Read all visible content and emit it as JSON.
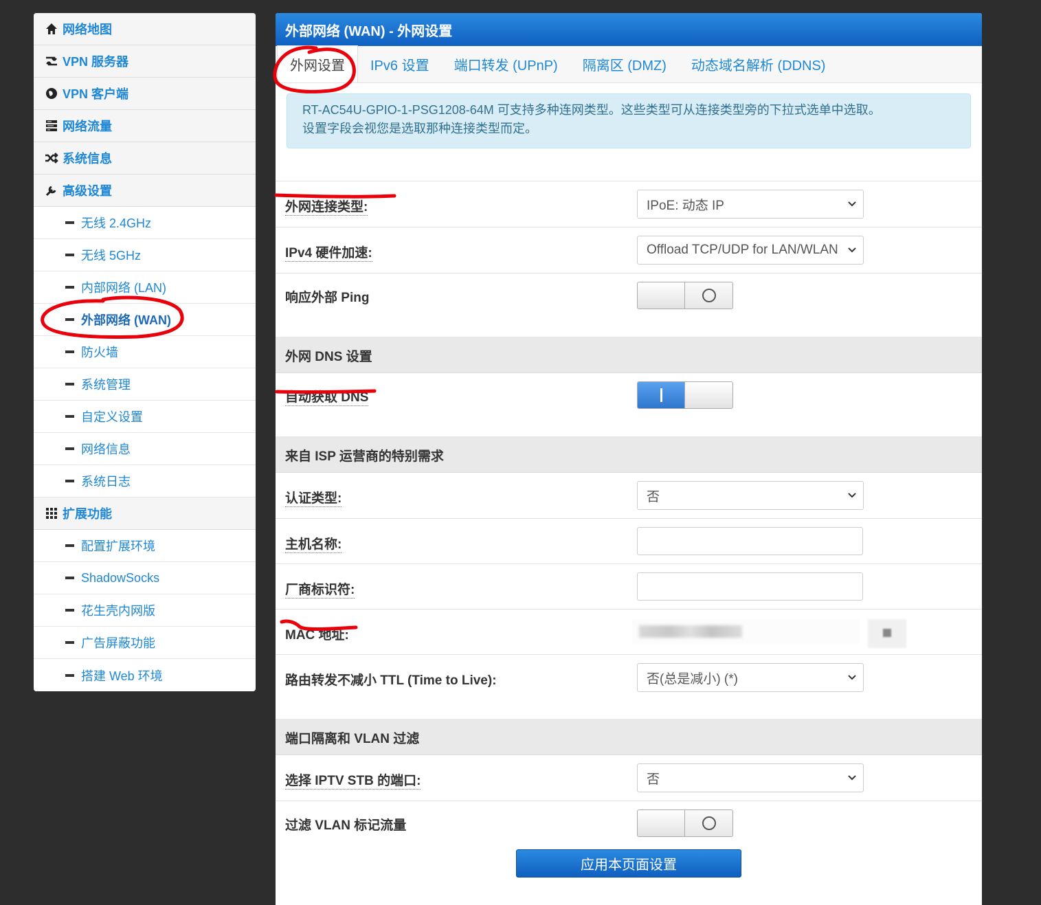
{
  "sidebar": {
    "items": [
      {
        "label": "网络地图",
        "icon": "home-icon"
      },
      {
        "label": "VPN 服务器",
        "icon": "retweet-icon"
      },
      {
        "label": "VPN 客户端",
        "icon": "globe-icon"
      },
      {
        "label": "网络流量",
        "icon": "tasks-icon"
      },
      {
        "label": "系统信息",
        "icon": "random-icon"
      },
      {
        "label": "高级设置",
        "icon": "wrench-icon"
      },
      {
        "label": "无线 2.4GHz"
      },
      {
        "label": "无线 5GHz"
      },
      {
        "label": "内部网络 (LAN)"
      },
      {
        "label": "外部网络 (WAN)"
      },
      {
        "label": "防火墙"
      },
      {
        "label": "系统管理"
      },
      {
        "label": "自定义设置"
      },
      {
        "label": "网络信息"
      },
      {
        "label": "系统日志"
      },
      {
        "label": "扩展功能",
        "icon": "grid-icon"
      },
      {
        "label": "配置扩展环境"
      },
      {
        "label": "ShadowSocks"
      },
      {
        "label": "花生壳内网版"
      },
      {
        "label": "广告屏蔽功能"
      },
      {
        "label": "搭建 Web 环境"
      }
    ]
  },
  "header": {
    "title": "外部网络 (WAN) - 外网设置"
  },
  "tabs": [
    "外网设置",
    "IPv6 设置",
    "端口转发 (UPnP)",
    "隔离区 (DMZ)",
    "动态域名解析 (DDNS)"
  ],
  "info": {
    "line1": "RT-AC54U-GPIO-1-PSG1208-64M 可支持多种连网类型。这些类型可从连接类型旁的下拉式选单中选取。",
    "line2": "设置字段会视您是选取那种连接类型而定。"
  },
  "form": {
    "wan_type_label": "外网连接类型:",
    "wan_type_value": "IPoE: 动态 IP",
    "hw_accel_label": "IPv4 硬件加速:",
    "hw_accel_value": "Offload TCP/UDP for LAN/WLAN",
    "ping_label": "响应外部 Ping",
    "dns_section": "外网 DNS 设置",
    "dns_auto_label": "自动获取 DNS",
    "isp_section": "来自 ISP 运营商的特别需求",
    "auth_label": "认证类型:",
    "auth_value": "否",
    "hostname_label": "主机名称:",
    "hostname_value": "",
    "vendor_label": "厂商标识符:",
    "vendor_value": "",
    "mac_label": "MAC 地址:",
    "ttl_label": "路由转发不减小 TTL (Time to Live):",
    "ttl_value": "否(总是减小) (*)",
    "vlan_section": "端口隔离和 VLAN 过滤",
    "iptv_label": "选择 IPTV STB 的端口:",
    "iptv_value": "否",
    "vlan_filter_label": "过滤 VLAN 标记流量",
    "apply_label": "应用本页面设置"
  },
  "toggles": {
    "ping": false,
    "dns_auto": true,
    "vlan_filter": false
  },
  "colors": {
    "accent": "#1e87d6",
    "header": "#0f5fc0",
    "annotation": "#e8000b"
  }
}
